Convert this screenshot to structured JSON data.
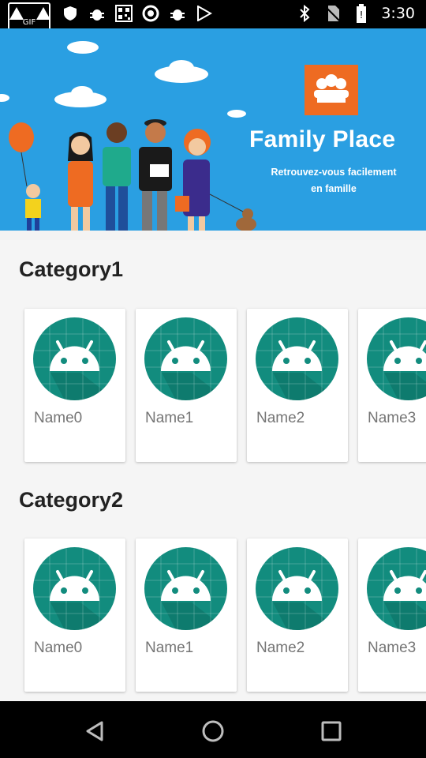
{
  "status_bar": {
    "time": "3:30",
    "overlay_badge": "GIF",
    "left_icons": [
      "warning-icon",
      "shield-icon",
      "bug-icon",
      "qr-code-icon",
      "circle-icon",
      "bug-icon",
      "play-store-icon"
    ],
    "right_icons": [
      "bluetooth-icon",
      "no-sim-icon",
      "battery-icon"
    ]
  },
  "banner": {
    "brand": "Family Place",
    "tagline_line1": "Retrouvez-vous facilement",
    "tagline_line2": "en famille",
    "colors": {
      "sky": "#2a9fe2",
      "logo": "#ee6b22"
    }
  },
  "categories": [
    {
      "title": "Category1",
      "items": [
        "Name0",
        "Name1",
        "Name2",
        "Name3"
      ]
    },
    {
      "title": "Category2",
      "items": [
        "Name0",
        "Name1",
        "Name2",
        "Name3"
      ]
    }
  ],
  "colors": {
    "avatar": "#128c7e",
    "avatar_dark": "#0b6d61",
    "robot": "#ffffff"
  },
  "nav_bar": {
    "icons": [
      "back-icon",
      "home-icon",
      "recents-icon"
    ]
  }
}
